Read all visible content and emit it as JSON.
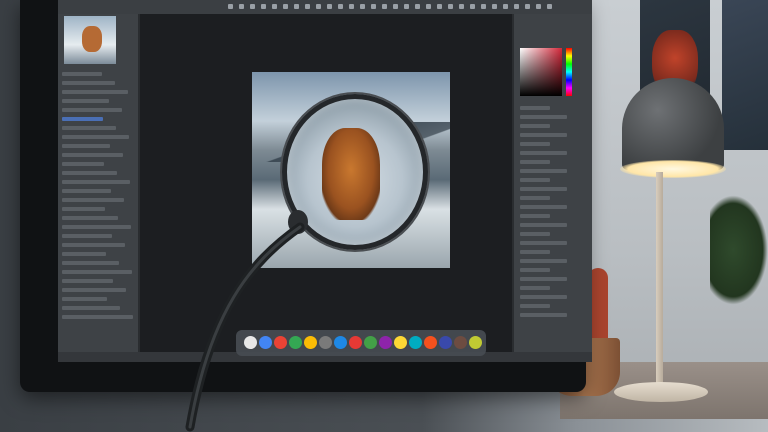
{
  "scene": {
    "description_free": true,
    "elements": [
      "monitor",
      "photo-editor-screen",
      "magnifying-lens",
      "desk-lamp",
      "cactus",
      "wall-posters"
    ]
  },
  "colors": {
    "wall": "#3a3f44",
    "lamp_glow": "#ffe6a8",
    "accent_red": "#d3283a",
    "ui_panel": "#3e4246",
    "canvas": "#1c1e21"
  }
}
